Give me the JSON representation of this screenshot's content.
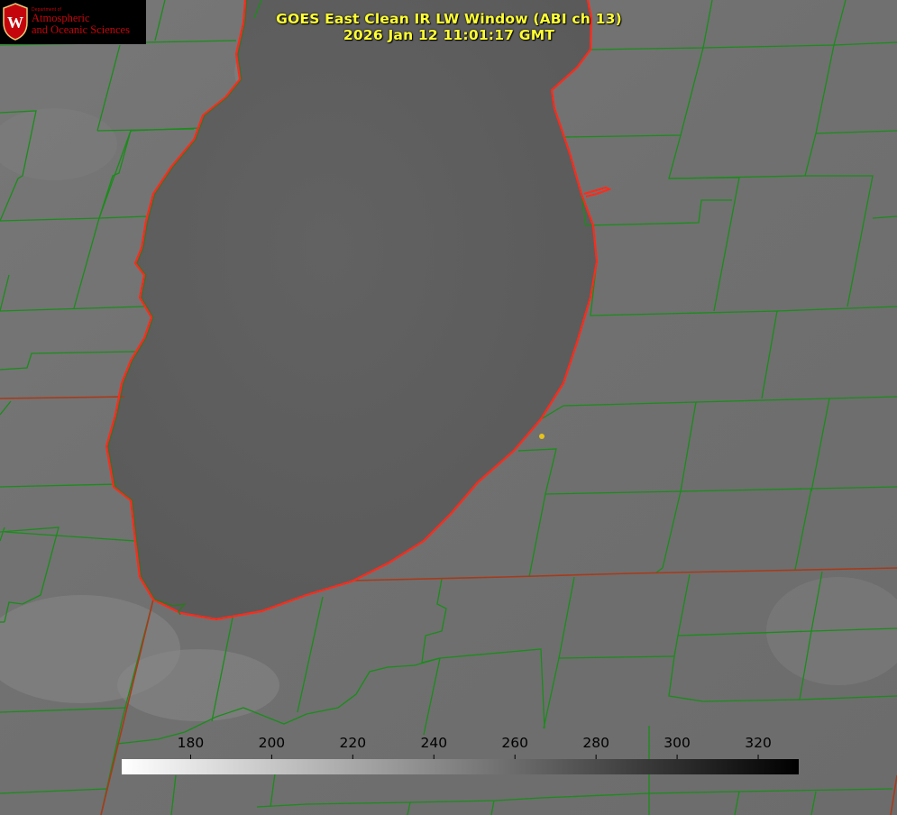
{
  "title": {
    "line1": "GOES East Clean IR LW Window (ABI ch 13)",
    "line2": "2026 Jan 12 11:01:17 GMT"
  },
  "logo": {
    "dept": "Department of",
    "line1": "Atmospheric",
    "line2": "and Oceanic Sciences",
    "icon": "wisconsin-crest-icon",
    "color": "#c5050c"
  },
  "colorbar": {
    "min": 163,
    "max": 330,
    "ticks": [
      180,
      200,
      220,
      240,
      260,
      280,
      300,
      320
    ],
    "gradient": "white-to-black",
    "unit": ""
  },
  "colors": {
    "county_lines": "#1a8c1a",
    "state_lines": "#a83a1a",
    "lake_outline": "#ff2a1a",
    "title": "#ffff33",
    "marker": "#e6c21a"
  }
}
